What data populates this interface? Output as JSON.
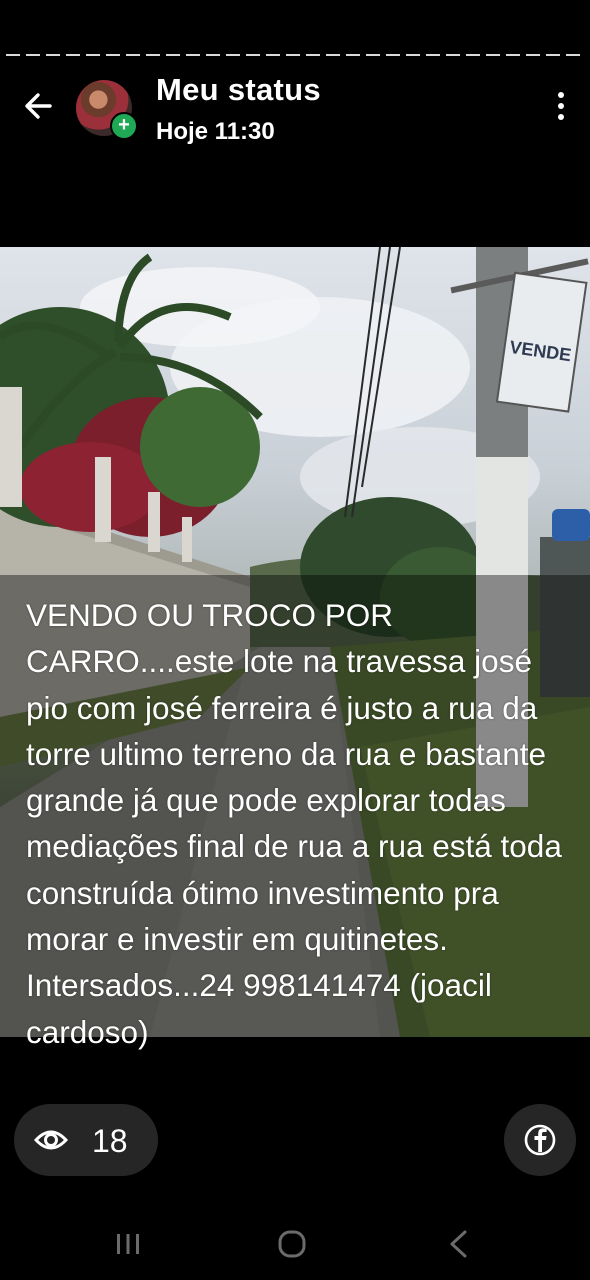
{
  "header": {
    "title": "Meu status",
    "time": "Hoje 11:30",
    "icons": {
      "back": "arrow-left-icon",
      "add": "plus-icon",
      "menu": "more-vert-icon"
    }
  },
  "status": {
    "caption": "VENDO OU TROCO POR CARRO....este lote na travessa josé pio com josé ferreira é justo a rua da torre ultimo terreno da rua e bastante grande já que pode explorar todas mediações final de rua a rua está toda construída ótimo investimento pra morar e investir em quitinetes. Intersados...24 998141474 (joacil cardoso)",
    "sign_text": "VENDE"
  },
  "footer": {
    "views": "18",
    "icons": {
      "views": "eye-icon",
      "share": "facebook-icon"
    }
  },
  "colors": {
    "background": "#000000",
    "accent_green": "#1fa855",
    "pill_background": "#262626"
  }
}
